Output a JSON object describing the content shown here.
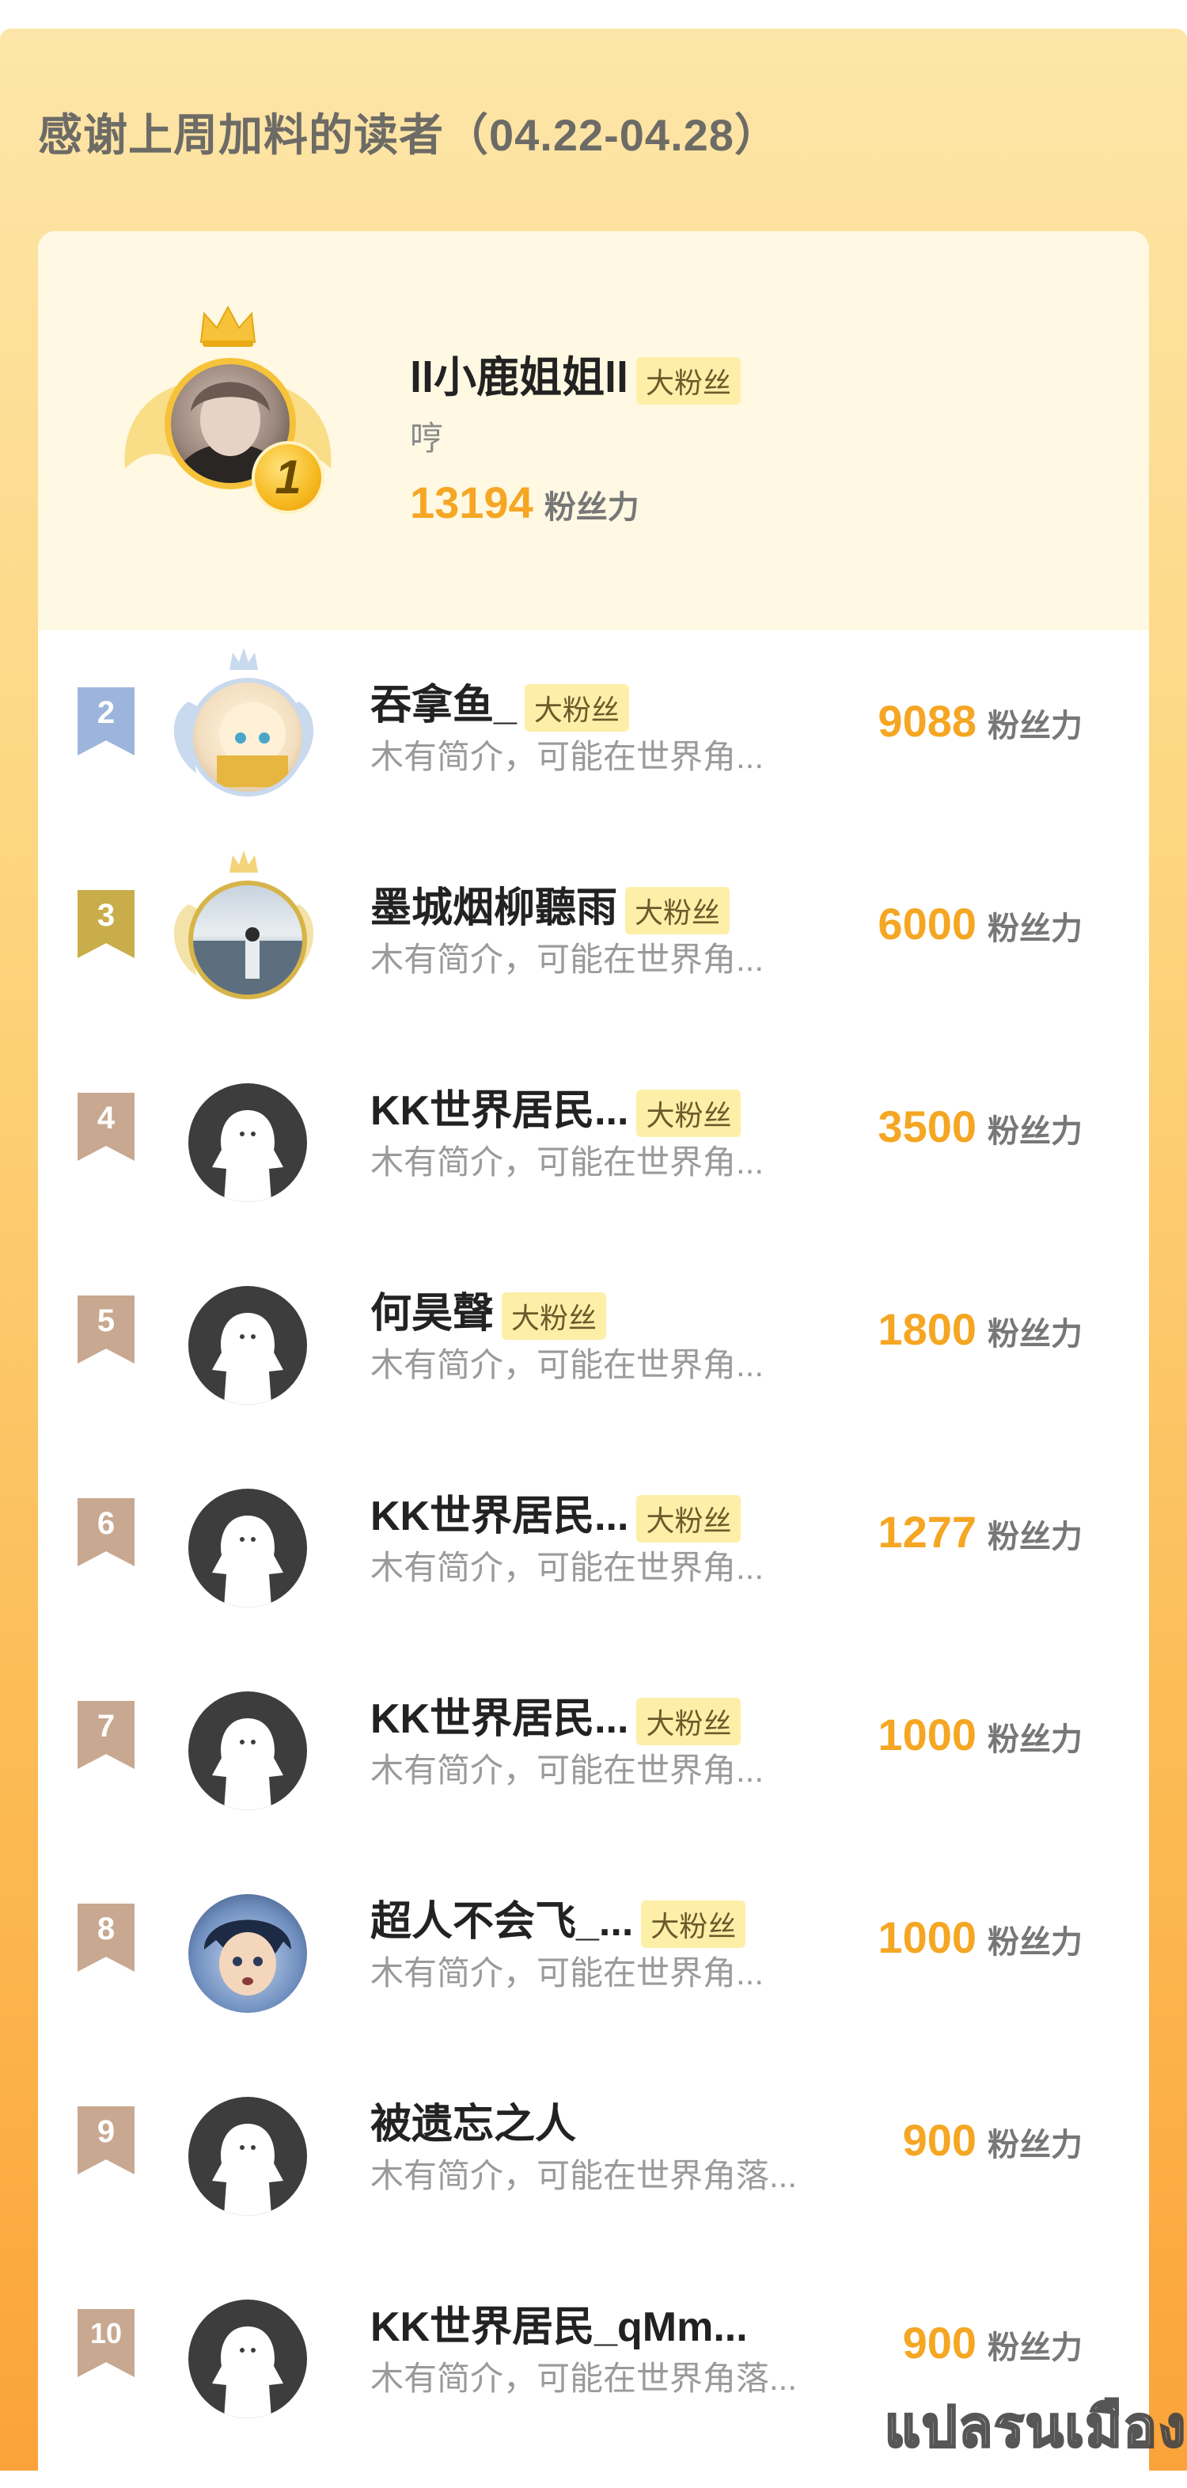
{
  "header": {
    "title": "感谢上周加料的读者（04.22-04.28）"
  },
  "top_fan": {
    "rank": "1",
    "name": "ll小鹿姐姐ll",
    "badge": "大粉丝",
    "bio": "哼",
    "score": "13194",
    "score_unit": "粉丝力"
  },
  "fans": [
    {
      "rank": "2",
      "name": "吞拿鱼_",
      "badge": "大粉丝",
      "bio": "木有简介，可能在世界角...",
      "score": "9088",
      "score_unit": "粉丝力",
      "avatar": "anime-girl-avatar"
    },
    {
      "rank": "3",
      "name": "墨城烟柳聽雨",
      "badge": "大粉丝",
      "bio": "木有简介，可能在世界角...",
      "score": "6000",
      "score_unit": "粉丝力",
      "avatar": "lake-photo-avatar"
    },
    {
      "rank": "4",
      "name": "KK世界居民...",
      "badge": "大粉丝",
      "bio": "木有简介，可能在世界角...",
      "score": "3500",
      "score_unit": "粉丝力",
      "avatar": "default-avatar"
    },
    {
      "rank": "5",
      "name": "何昊聲",
      "badge": "大粉丝",
      "bio": "木有简介，可能在世界角...",
      "score": "1800",
      "score_unit": "粉丝力",
      "avatar": "default-avatar"
    },
    {
      "rank": "6",
      "name": "KK世界居民...",
      "badge": "大粉丝",
      "bio": "木有简介，可能在世界角...",
      "score": "1277",
      "score_unit": "粉丝力",
      "avatar": "default-avatar"
    },
    {
      "rank": "7",
      "name": "KK世界居民...",
      "badge": "大粉丝",
      "bio": "木有简介，可能在世界角...",
      "score": "1000",
      "score_unit": "粉丝力",
      "avatar": "default-avatar"
    },
    {
      "rank": "8",
      "name": "超人不会飞_...",
      "badge": "大粉丝",
      "bio": "木有简介，可能在世界角...",
      "score": "1000",
      "score_unit": "粉丝力",
      "avatar": "anime-boy-avatar"
    },
    {
      "rank": "9",
      "name": "被遗忘之人",
      "badge": "",
      "bio": "木有简介，可能在世界角落...",
      "score": "900",
      "score_unit": "粉丝力",
      "avatar": "default-avatar"
    },
    {
      "rank": "10",
      "name": "KK世界居民_qMm...",
      "badge": "",
      "bio": "木有简介，可能在世界角落...",
      "score": "900",
      "score_unit": "粉丝力",
      "avatar": "default-avatar"
    }
  ],
  "colors": {
    "accent_orange": "#f5a623",
    "rank2": "#9db5dc",
    "rank3": "#c9ad4a",
    "rank_other": "#c8a890",
    "badge_bg": "#fdefa8"
  },
  "watermark": "แปลรนเมือง"
}
